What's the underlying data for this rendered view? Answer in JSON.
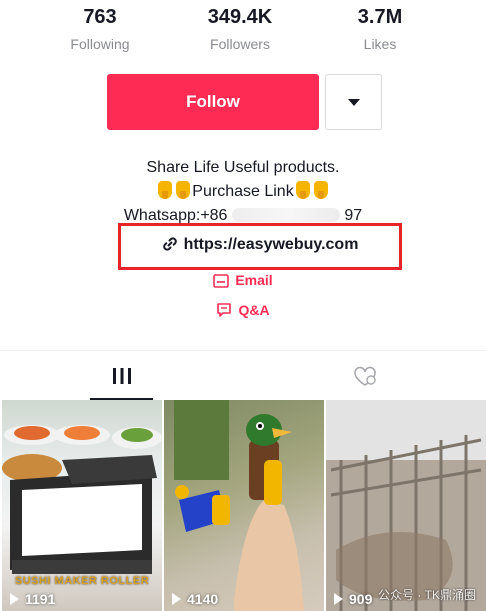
{
  "stats": [
    {
      "number": "763",
      "label": "Following"
    },
    {
      "number": "349.4K",
      "label": "Followers"
    },
    {
      "number": "3.7M",
      "label": "Likes"
    }
  ],
  "follow_button": {
    "label": "Follow"
  },
  "bio": {
    "line1": "Share Life Useful products.",
    "line2_text": "Purchase Link",
    "line3_prefix": "Whatsapp:+86",
    "line3_suffix": "97"
  },
  "link": {
    "url": "https://easywebuy.com"
  },
  "contacts": {
    "email": "Email",
    "qa": "Q&A"
  },
  "tabs": [
    "videos",
    "liked"
  ],
  "videos": [
    {
      "views": "1191",
      "caption": "SUSHI MAKER ROLLER"
    },
    {
      "views": "4140",
      "caption": ""
    },
    {
      "views": "909",
      "caption": ""
    }
  ],
  "watermark": "公众号 · TK鼎涌圈",
  "colors": {
    "accent": "#fe2c55",
    "highlight_box": "#e8242a"
  }
}
